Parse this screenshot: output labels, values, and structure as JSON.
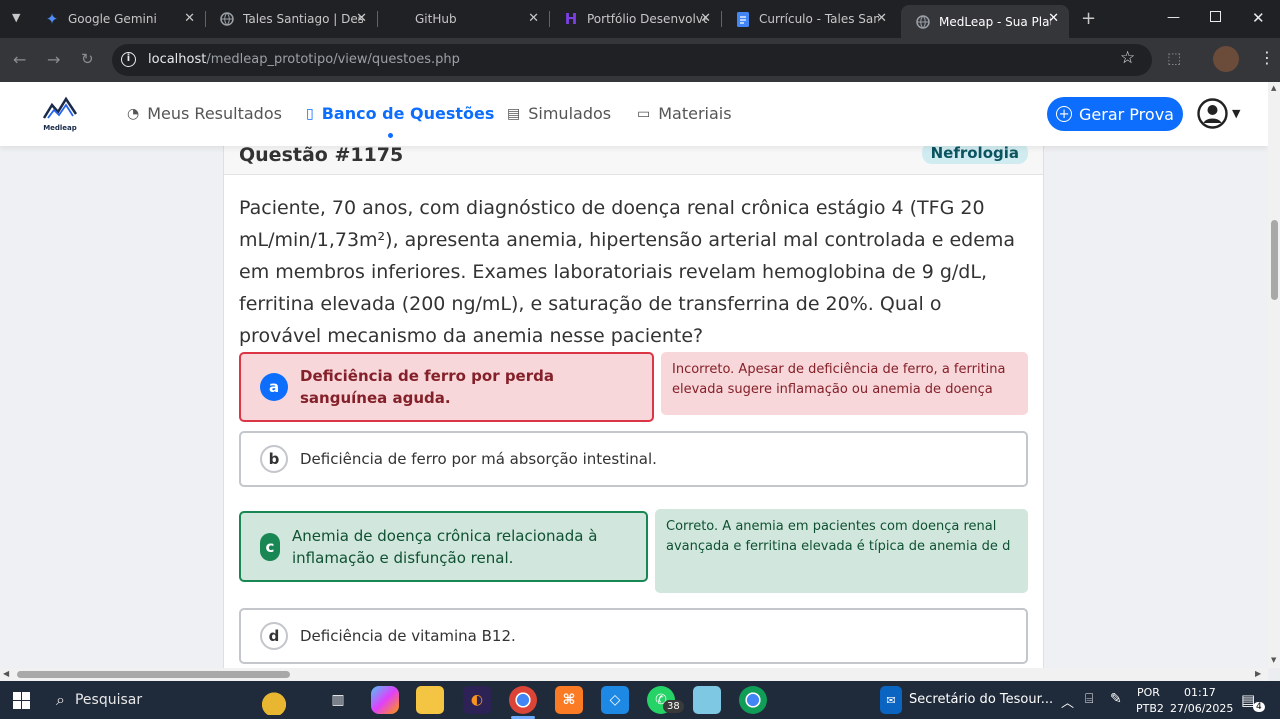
{
  "browser": {
    "tabs": [
      {
        "title": "Google Gemini",
        "icon": "gemini-icon"
      },
      {
        "title": "Tales Santiago | Dese",
        "icon": "globe-icon"
      },
      {
        "title": "GitHub",
        "icon": "github-icon"
      },
      {
        "title": "Portfólio Desenvolve",
        "icon": "portfolio-icon"
      },
      {
        "title": "Currículo - Tales Sant",
        "icon": "docs-icon"
      },
      {
        "title": "MedLeap - Sua Plataf",
        "icon": "globe-icon"
      }
    ],
    "url_host": "localhost",
    "url_path": "/medleap_prototipo/view/questoes.php"
  },
  "navbar": {
    "logo_text": "Medleap",
    "items": [
      {
        "label": "Meus Resultados",
        "icon": "gauge-icon"
      },
      {
        "label": "Banco de Questões",
        "icon": "book-icon"
      },
      {
        "label": "Simulados",
        "icon": "document-icon"
      },
      {
        "label": "Materiais",
        "icon": "box-icon"
      }
    ],
    "active_index": 1,
    "cta_label": "Gerar Prova"
  },
  "question": {
    "title": "Questão #1175",
    "tag": "Nefrologia",
    "text": "Paciente, 70 anos, com diagnóstico de doença renal crônica estágio 4 (TFG 20 mL/min/1,73m²), apresenta anemia, hipertensão arterial mal controlada e edema em membros inferiores. Exames laboratoriais revelam hemoglobina de 9 g/dL, ferritina elevada (200 ng/mL), e saturação de transferrina de 20%. Qual o provável mecanismo da anemia nesse paciente?",
    "options": [
      {
        "letter": "a",
        "text": "Deficiência de ferro por perda sanguínea aguda.",
        "state": "incorrect",
        "feedback": "Incorreto. Apesar de deficiência de ferro, a ferritina elevada sugere inflamação ou anemia de doença"
      },
      {
        "letter": "b",
        "text": "Deficiência de ferro por má absorção intestinal.",
        "state": "neutral",
        "feedback": ""
      },
      {
        "letter": "c",
        "text": "Anemia de doença crônica relacionada à inflamação e disfunção renal.",
        "state": "correct",
        "feedback": "Correto. A anemia em pacientes com doença renal avançada e ferritina elevada é típica de anemia de d"
      },
      {
        "letter": "d",
        "text": "Deficiência de vitamina B12.",
        "state": "neutral",
        "feedback": ""
      }
    ]
  },
  "colors": {
    "primary": "#0d6efd",
    "incorrect_bg": "#f8d7da",
    "incorrect_border": "#dc3545",
    "incorrect_text": "#842029",
    "correct_bg": "#d1e7dd",
    "correct_border": "#198754",
    "correct_text": "#0f5132"
  },
  "taskbar": {
    "search_placeholder": "Pesquisar",
    "whatsapp_badge": "38",
    "notification": "Secretário do Tesour...",
    "lang_top": "POR",
    "lang_bottom": "PTB2",
    "time": "01:17",
    "date": "27/06/2025",
    "notif_count": "4"
  }
}
